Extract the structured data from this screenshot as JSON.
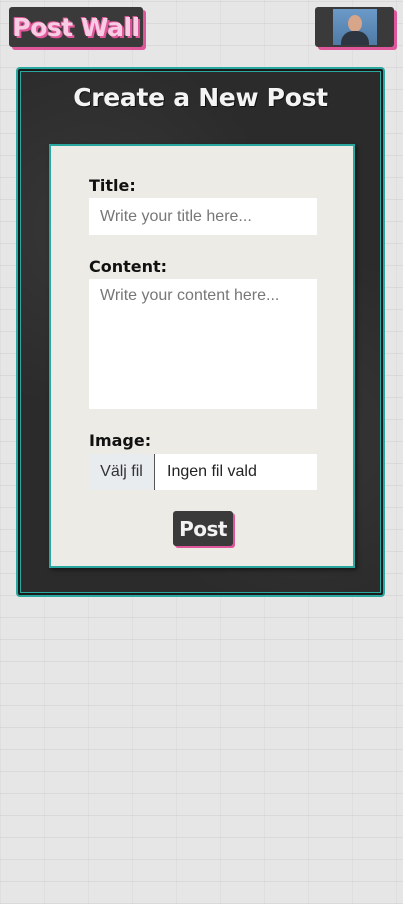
{
  "header": {
    "logo_text": "Post Wall",
    "avatar_icon": "user-avatar-photo"
  },
  "form": {
    "title": "Create a New Post",
    "title_label": "Title:",
    "title_placeholder": "Write your title here...",
    "title_value": "",
    "content_label": "Content:",
    "content_placeholder": "Write your content here...",
    "content_value": "",
    "image_label": "Image:",
    "file_button_label": "Välj fil",
    "file_status": "Ingen fil vald",
    "submit_label": "Post"
  },
  "colors": {
    "accent_pink": "#e0569a",
    "accent_teal": "#2aa8a0",
    "dark_panel": "#2b2b2b",
    "light_panel": "#ecebe6"
  }
}
